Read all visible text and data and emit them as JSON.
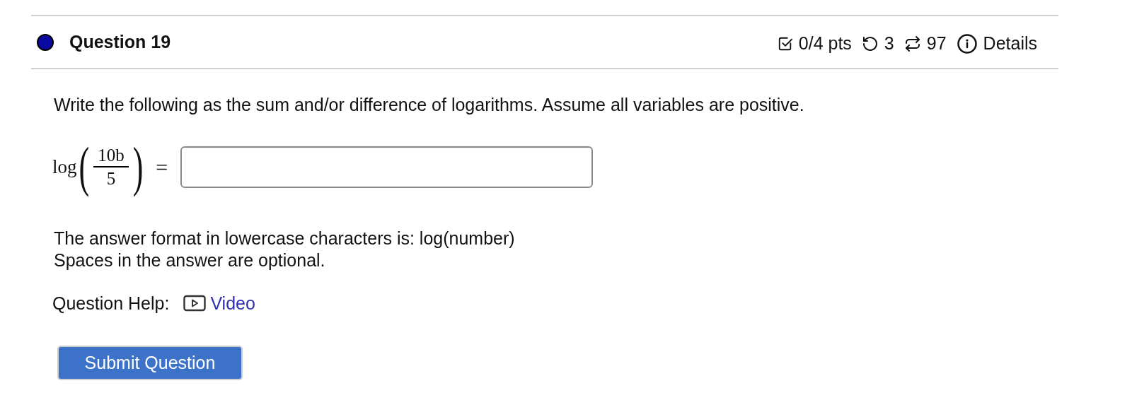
{
  "question": {
    "title": "Question 19",
    "color": "#0a0aa0"
  },
  "meta": [
    {
      "kind": "points",
      "text": "0/4 pts"
    },
    {
      "kind": "retries",
      "text": "3"
    },
    {
      "kind": "attempts",
      "text": "97"
    },
    {
      "kind": "details",
      "text": "Details"
    }
  ],
  "prompt": "Write the following as the sum and/or difference of logarithms. Assume all variables are positive.",
  "expression": {
    "function": "log",
    "open": "(",
    "numerator": "10b",
    "denominator": "5",
    "close": ")",
    "equals": "="
  },
  "notes": [
    "The answer format in lowercase characters is: log(number)",
    "Spaces in the answer are optional."
  ],
  "help": {
    "label": "Question Help:",
    "link": "Video"
  },
  "submit": "Submit Question"
}
